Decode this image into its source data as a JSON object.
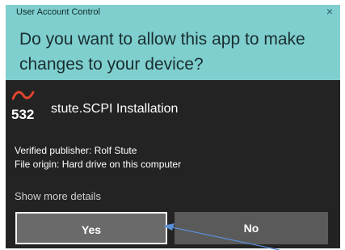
{
  "dialog": {
    "header_title": "User Account Control",
    "close_symbol": "×",
    "question": "Do you want to allow this app to make changes to your device?",
    "app_logo_text": "532",
    "app_name": "stute.SCPI Installation",
    "publisher": "Verified publisher: Rolf Stute",
    "file_origin": "File origin: Hard drive on this computer",
    "show_more": "Show more details",
    "yes_label": "Yes",
    "no_label": "No"
  },
  "colors": {
    "header_bg": "#7fcfcf",
    "body_bg": "#232323",
    "logo_accent": "#e0452e",
    "annotation_arrow": "#5a8fd8"
  },
  "icons": {
    "close": "close-icon",
    "app_logo": "app-logo-icon",
    "annotation_arrow": "arrow-annotation"
  }
}
